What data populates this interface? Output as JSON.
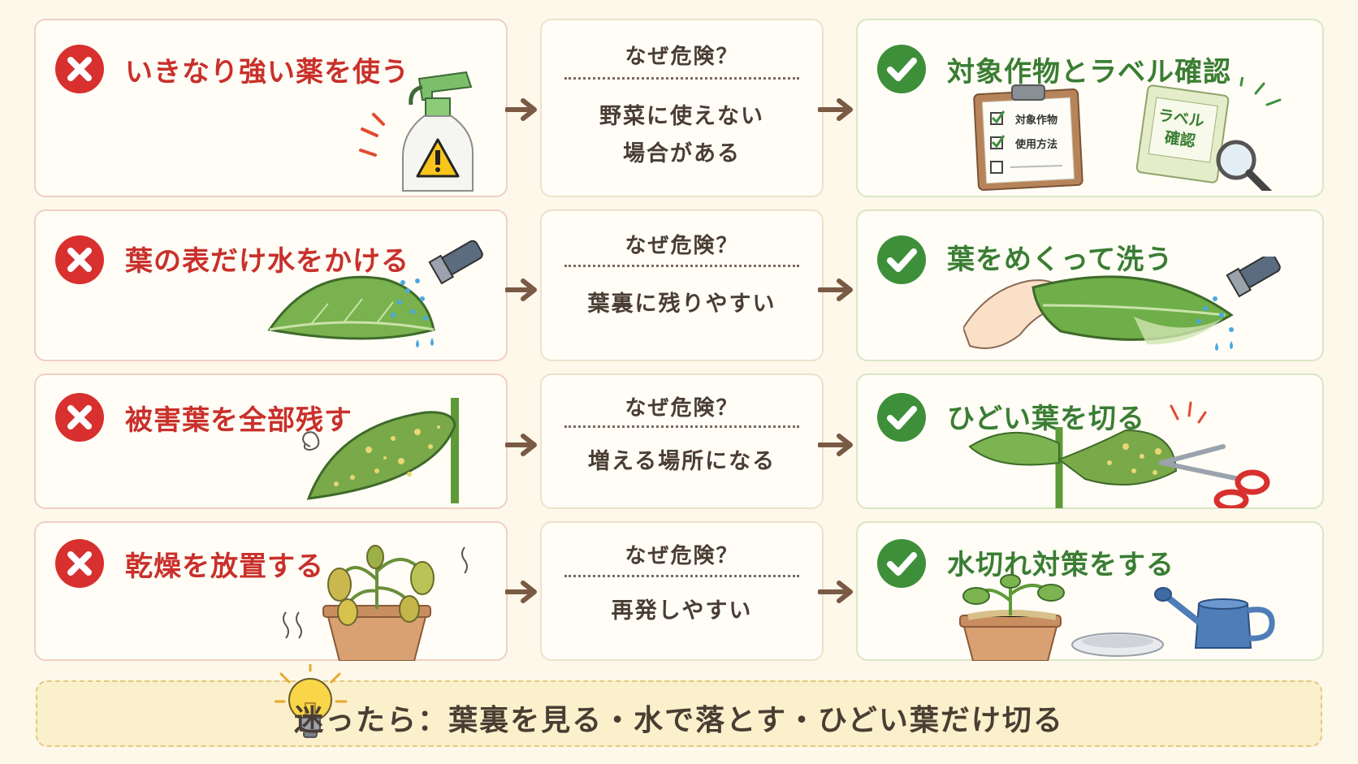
{
  "rows": [
    {
      "mistake": "いきなり強い薬を使う",
      "why_label": "なぜ危険？",
      "why_lines": [
        "野菜に使えない",
        "場合がある"
      ],
      "fix": "対象作物とラベル確認",
      "illus_text": {
        "check1": "対象作物",
        "check2": "使用方法",
        "label_line1": "ラベル",
        "label_line2": "確認"
      }
    },
    {
      "mistake": "葉の表だけ水をかける",
      "why_label": "なぜ危険？",
      "why_lines": [
        "葉裏に残りやすい"
      ],
      "fix": "葉をめくって洗う"
    },
    {
      "mistake": "被害葉を全部残す",
      "why_label": "なぜ危険？",
      "why_lines": [
        "増える場所になる"
      ],
      "fix": "ひどい葉を切る"
    },
    {
      "mistake": "乾燥を放置する",
      "why_label": "なぜ危険？",
      "why_lines": [
        "再発しやすい"
      ],
      "fix": "水切れ対策をする"
    }
  ],
  "tip": "迷ったら：葉裏を見る・水で落とす・ひどい葉だけ切る",
  "colors": {
    "bad": "#d8302e",
    "good": "#3e8f3a",
    "arrow": "#7a5a44",
    "background": "#fdf8ea"
  },
  "icons": {
    "bad": "x-circle-icon",
    "good": "check-circle-icon",
    "tip": "lightbulb-icon"
  }
}
